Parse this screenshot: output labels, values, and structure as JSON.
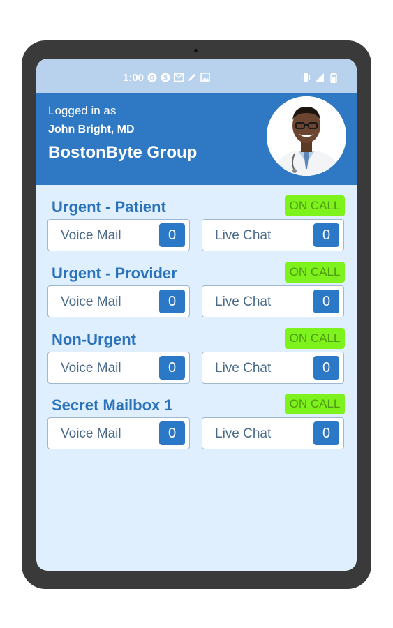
{
  "status_bar": {
    "time": "1:00",
    "left_icons": [
      "g-icon",
      "s-icon",
      "gmail-icon",
      "pencil-icon",
      "image-icon"
    ],
    "right_icons": [
      "vibrate-icon",
      "signal-icon",
      "battery-icon"
    ]
  },
  "header": {
    "logged_in_label": "Logged in as",
    "user_name": "John Bright, MD",
    "group_name": "BostonByte Group"
  },
  "colors": {
    "header_bg": "#2e78c4",
    "screen_bg": "#e0effd",
    "on_call_bg": "#7ef21d",
    "count_bg": "#2a78c6",
    "title_text": "#2a72bb"
  },
  "sections": [
    {
      "title": "Urgent - Patient",
      "status": "ON CALL",
      "voice_mail_label": "Voice Mail",
      "voice_mail_count": "0",
      "live_chat_label": "Live Chat",
      "live_chat_count": "0"
    },
    {
      "title": "Urgent - Provider",
      "status": "ON CALL",
      "voice_mail_label": "Voice Mail",
      "voice_mail_count": "0",
      "live_chat_label": "Live Chat",
      "live_chat_count": "0"
    },
    {
      "title": "Non-Urgent",
      "status": "ON CALL",
      "voice_mail_label": "Voice Mail",
      "voice_mail_count": "0",
      "live_chat_label": "Live Chat",
      "live_chat_count": "0"
    },
    {
      "title": "Secret Mailbox 1",
      "status": "ON CALL",
      "voice_mail_label": "Voice Mail",
      "voice_mail_count": "0",
      "live_chat_label": "Live Chat",
      "live_chat_count": "0"
    }
  ]
}
